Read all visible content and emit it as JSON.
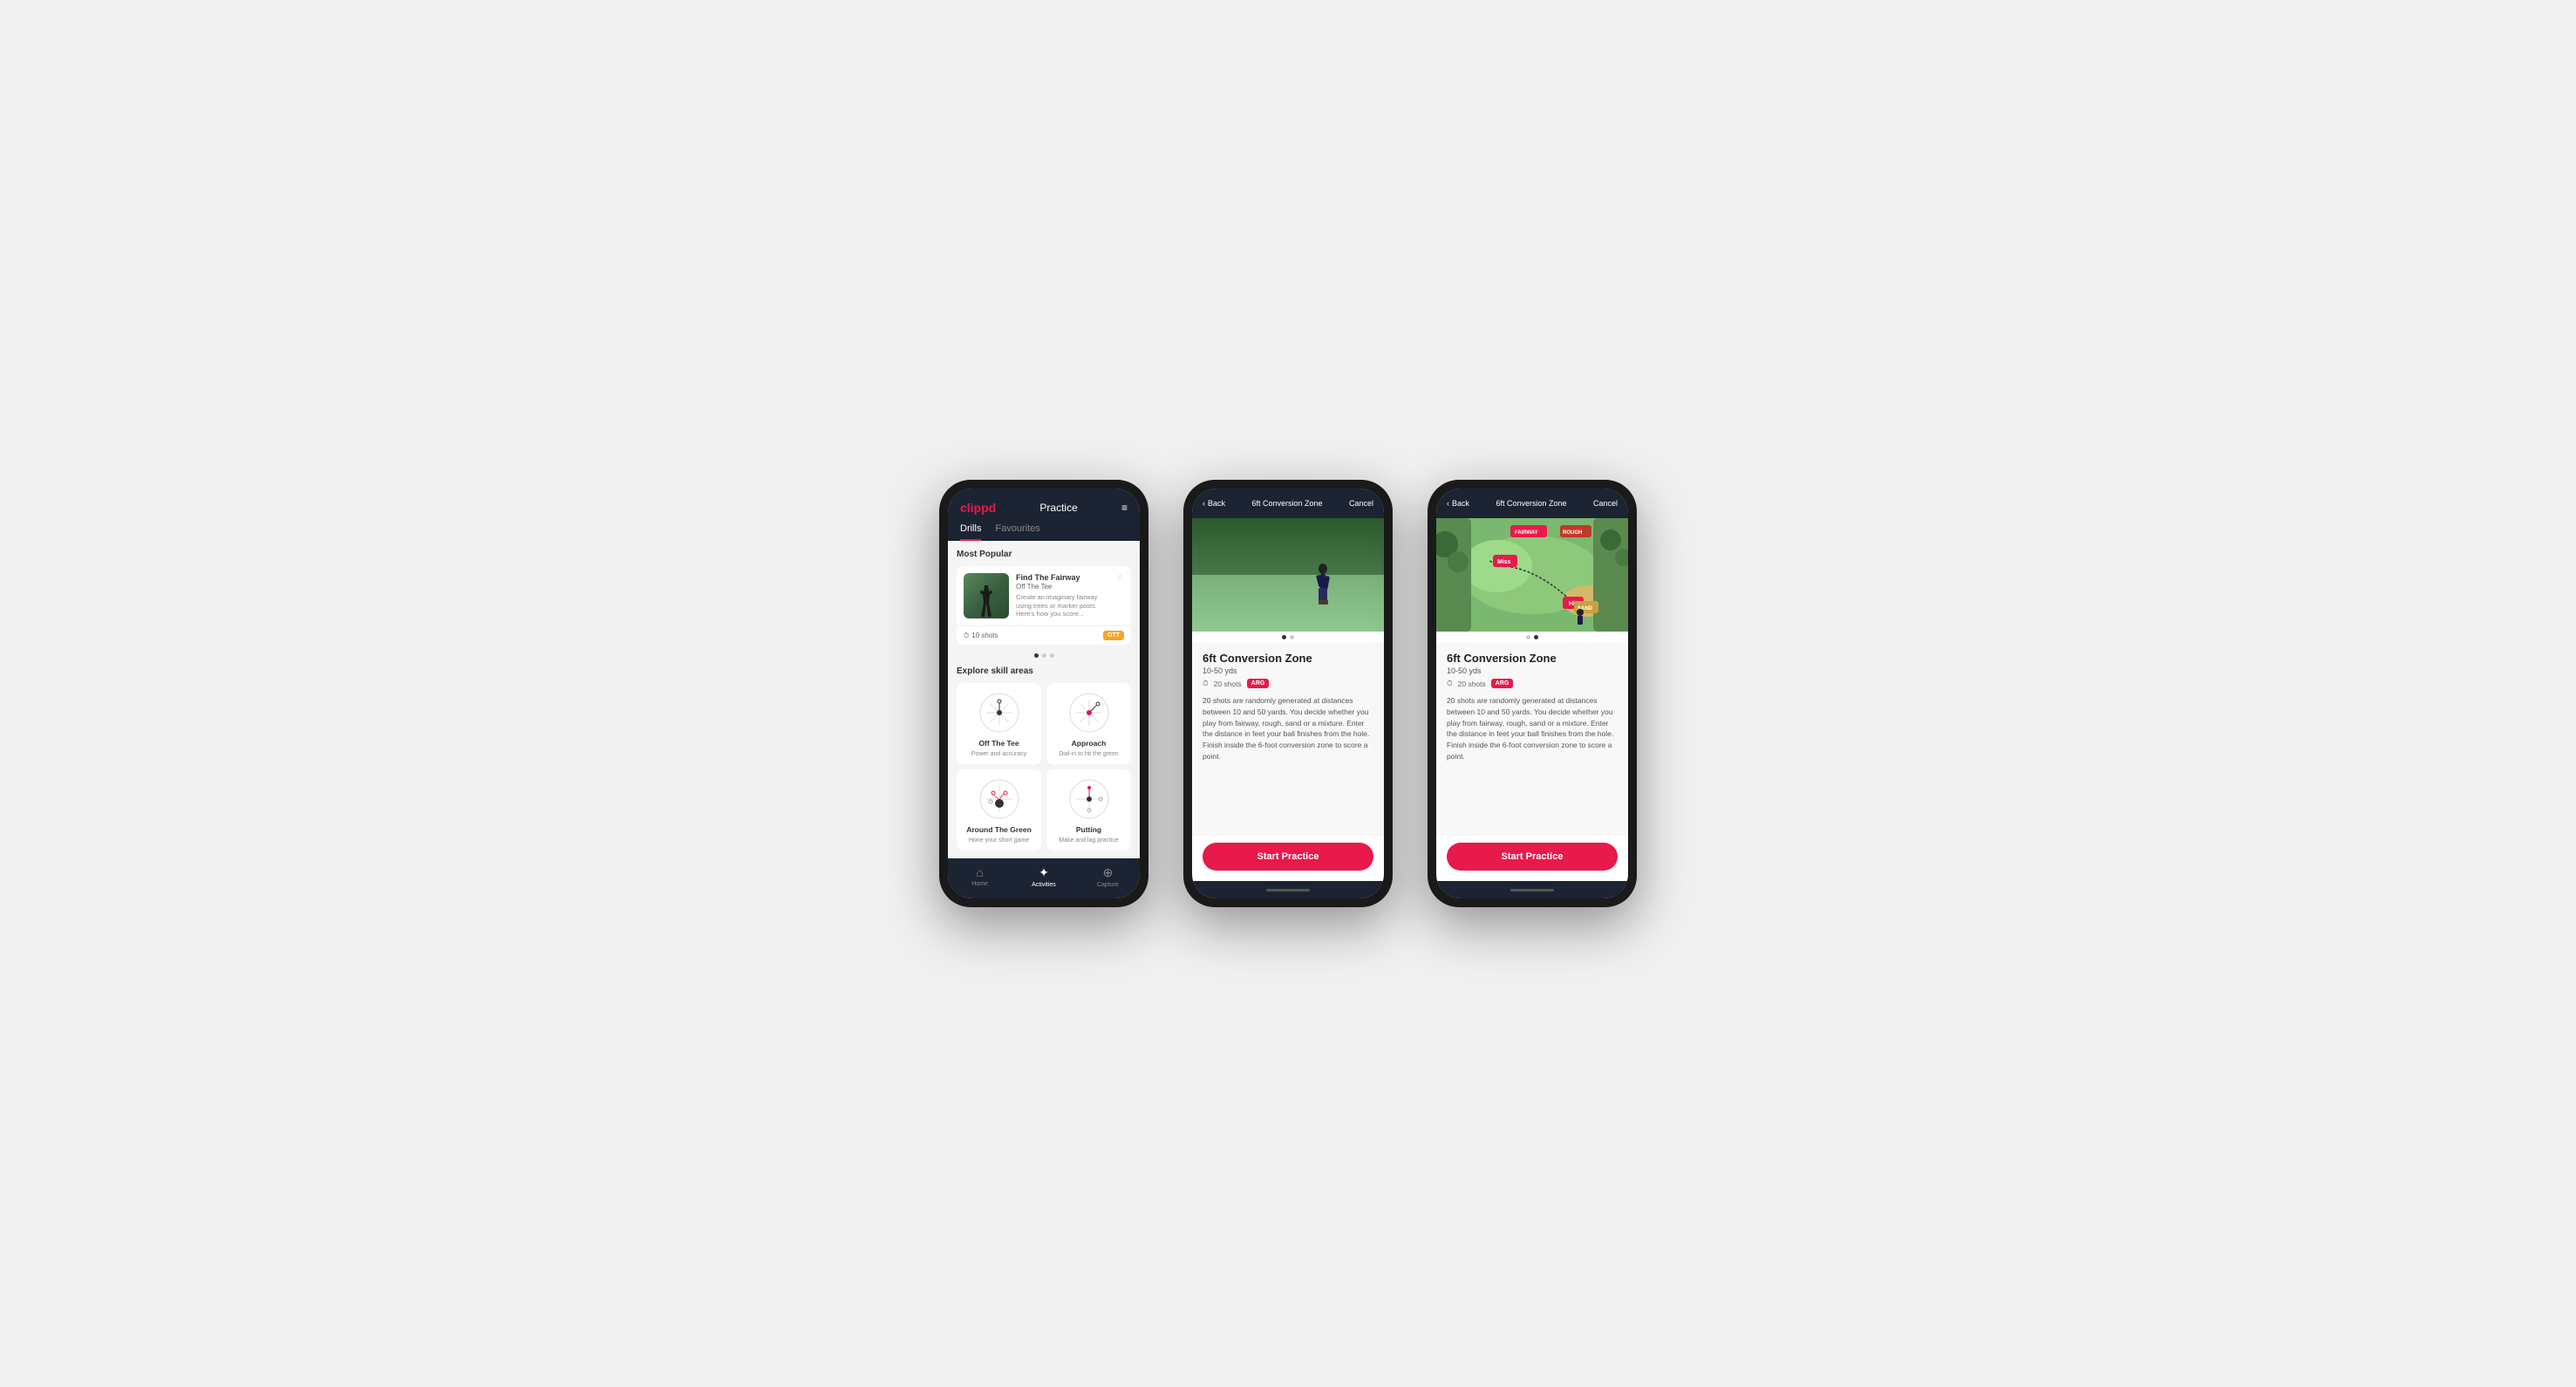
{
  "phone1": {
    "header": {
      "logo": "clippd",
      "title": "Practice",
      "menu_icon": "≡"
    },
    "tabs": [
      {
        "label": "Drills",
        "active": true
      },
      {
        "label": "Favourites",
        "active": false
      }
    ],
    "most_popular_title": "Most Popular",
    "featured_drill": {
      "name": "Find The Fairway",
      "category": "Off The Tee",
      "description": "Create an imaginary fairway using trees or marker posts. Here's how you score...",
      "shots": "10 shots",
      "badge": "OTT"
    },
    "explore_title": "Explore skill areas",
    "skills": [
      {
        "name": "Off The Tee",
        "desc": "Power and accuracy"
      },
      {
        "name": "Approach",
        "desc": "Dial-in to hit the green"
      },
      {
        "name": "Around The Green",
        "desc": "Hone your short game"
      },
      {
        "name": "Putting",
        "desc": "Make and lag practice"
      }
    ],
    "nav": [
      {
        "label": "Home",
        "icon": "⌂",
        "active": false
      },
      {
        "label": "Activities",
        "icon": "✦",
        "active": true
      },
      {
        "label": "Capture",
        "icon": "⊕",
        "active": false
      }
    ]
  },
  "phone2": {
    "header": {
      "back": "Back",
      "title": "6ft Conversion Zone",
      "cancel": "Cancel"
    },
    "drill": {
      "name": "6ft Conversion Zone",
      "range": "10-50 yds",
      "shots": "20 shots",
      "badge": "ARG",
      "description": "20 shots are randomly generated at distances between 10 and 50 yards. You decide whether you play from fairway, rough, sand or a mixture. Enter the distance in feet your ball finishes from the hole. Finish inside the 6-foot conversion zone to score a point."
    },
    "cta": "Start Practice",
    "image_type": "photo"
  },
  "phone3": {
    "header": {
      "back": "Back",
      "title": "6ft Conversion Zone",
      "cancel": "Cancel"
    },
    "drill": {
      "name": "6ft Conversion Zone",
      "range": "10-50 yds",
      "shots": "20 shots",
      "badge": "ARG",
      "description": "20 shots are randomly generated at distances between 10 and 50 yards. You decide whether you play from fairway, rough, sand or a mixture. Enter the distance in feet your ball finishes from the hole. Finish inside the 6-foot conversion zone to score a point."
    },
    "cta": "Start Practice",
    "image_type": "map",
    "map_labels": [
      "FAIRWAY",
      "ROUGH",
      "SAND",
      "Miss",
      "Hit"
    ]
  }
}
